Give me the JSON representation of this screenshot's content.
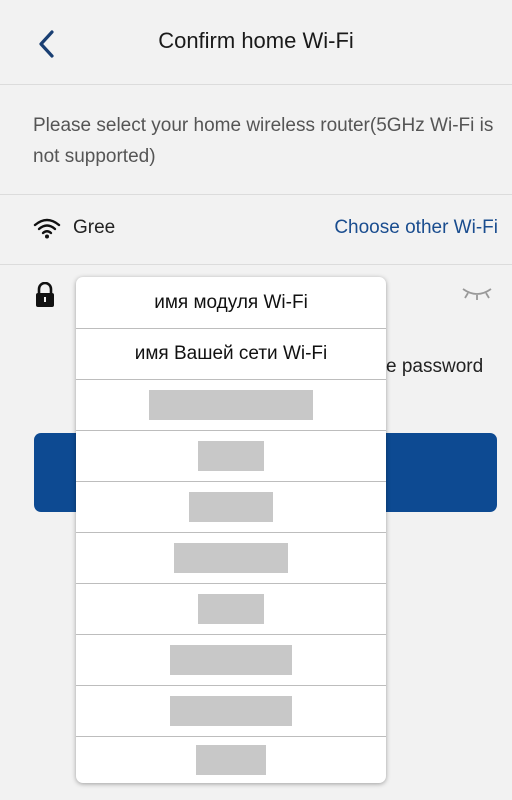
{
  "header": {
    "title": "Confirm home Wi-Fi",
    "back_icon": "chevron-left-icon"
  },
  "instruction": "Please select your home wireless router(5GHz Wi-Fi is not supported)",
  "wifi_row": {
    "icon": "wifi-icon",
    "network_name": "Gree",
    "choose_other_label": "Choose other Wi-Fi"
  },
  "password_row": {
    "icon": "lock-icon",
    "value": "",
    "visibility_icon": "eye-closed-icon"
  },
  "remember_label": "e password",
  "colors": {
    "accent": "#0d4a92",
    "link": "#1a4d8f",
    "background": "#f2f2f2",
    "redacted": "#c8c8c8"
  },
  "dropdown": {
    "items": [
      "имя модуля Wi-Fi",
      "имя Вашей сети Wi-Fi",
      "",
      "",
      "",
      "",
      "",
      "",
      "",
      ""
    ]
  }
}
